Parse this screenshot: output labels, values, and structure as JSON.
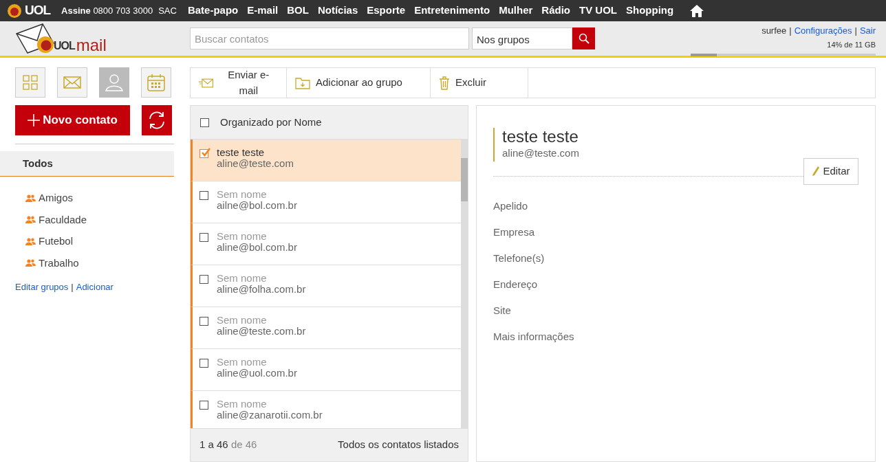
{
  "top_bar": {
    "logo_text": "UOL",
    "subscribe_label": "Assine",
    "phone": "0800 703 3000",
    "sac": "SAC",
    "nav": [
      "Bate-papo",
      "E-mail",
      "BOL",
      "Notícias",
      "Esporte",
      "Entretenimento",
      "Mulher",
      "Rádio",
      "TV UOL",
      "Shopping"
    ]
  },
  "header": {
    "logo_brand": "UOL",
    "logo_product": "mail",
    "search": {
      "placeholder": "Buscar contatos"
    },
    "scope": {
      "value": "Nos grupos"
    },
    "user": "surfee",
    "separator": "|",
    "links": [
      "Configurações",
      "Sair"
    ],
    "storage": {
      "reading": "14% de 11 GB",
      "level": 0.14
    }
  },
  "apps": [
    {
      "kind": "grid",
      "selected": false
    },
    {
      "kind": "mail",
      "selected": false
    },
    {
      "kind": "person",
      "selected": true
    },
    {
      "kind": "calendar",
      "selected": false
    }
  ],
  "new_contact": "Novo contato",
  "groups_header": "Todos",
  "groups": [
    "Amigos",
    "Faculdade",
    "Futebol",
    "Trabalho"
  ],
  "group_links": [
    "Editar grupos",
    "Adicionar"
  ],
  "group_links_separator": "|",
  "toolbar": [
    {
      "kind": "send",
      "label": "Enviar e-mail"
    },
    {
      "kind": "add",
      "label": "Adicionar ao grupo"
    },
    {
      "kind": "delete",
      "label": "Excluir"
    }
  ],
  "list": {
    "header": "Organizado por Nome",
    "header_checked": false,
    "contacts": [
      {
        "name": "teste teste",
        "email": "aline@teste.com",
        "checked": true,
        "selected": true,
        "unnamed": false
      },
      {
        "name": "Sem nome",
        "email": "ailne@bol.com.br",
        "checked": false,
        "selected": false,
        "unnamed": true
      },
      {
        "name": "Sem nome",
        "email": "aline@bol.com.br",
        "checked": false,
        "selected": false,
        "unnamed": true
      },
      {
        "name": "Sem nome",
        "email": "aline@folha.com.br",
        "checked": false,
        "selected": false,
        "unnamed": true
      },
      {
        "name": "Sem nome",
        "email": "aline@teste.com.br",
        "checked": false,
        "selected": false,
        "unnamed": true
      },
      {
        "name": "Sem nome",
        "email": "aline@uol.com.br",
        "checked": false,
        "selected": false,
        "unnamed": true
      },
      {
        "name": "Sem nome",
        "email": "aline@zanarotii.com.br",
        "checked": false,
        "selected": false,
        "unnamed": true
      }
    ],
    "pager": {
      "range": "1 a 46",
      "total": "de 46"
    },
    "status": "Todos os contatos listados"
  },
  "detail": {
    "name": "teste teste",
    "email": "aline@teste.com",
    "edit": "Editar",
    "fields": [
      "Apelido",
      "Empresa",
      "Telefone(s)",
      "Endereço",
      "Site",
      "Mais informações"
    ]
  }
}
